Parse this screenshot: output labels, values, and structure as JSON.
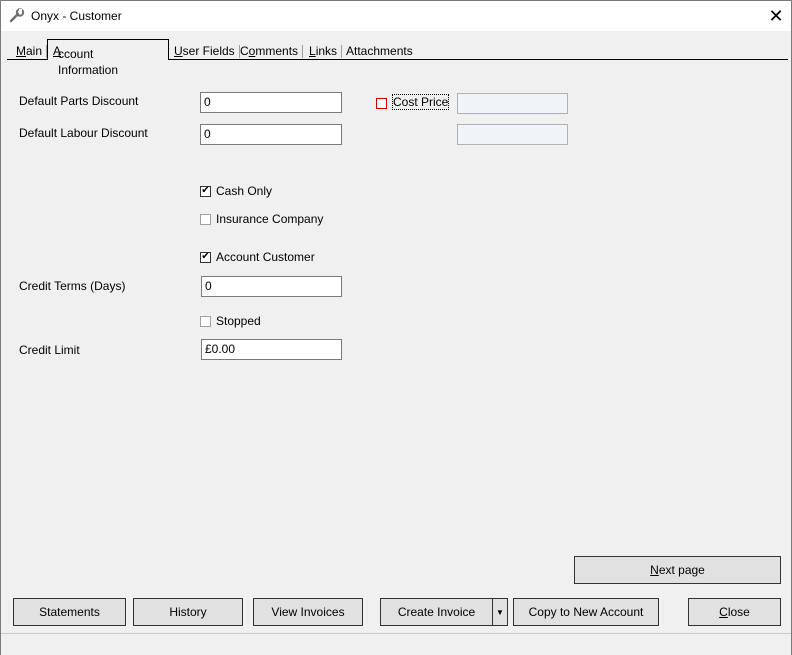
{
  "window": {
    "title": "Onyx - Customer",
    "close_glyph": "✕"
  },
  "tabs": [
    {
      "label_pre": "",
      "label_key": "M",
      "label_post": "ain"
    },
    {
      "label_pre": "",
      "label_key": "A",
      "label_post": "ccount Information"
    },
    {
      "label_pre": "",
      "label_key": "U",
      "label_post": "ser Fields"
    },
    {
      "label_pre": "C",
      "label_key": "o",
      "label_post": "mments"
    },
    {
      "label_pre": "",
      "label_key": "L",
      "label_post": "inks"
    },
    {
      "label_pre": "Attachments",
      "label_key": "",
      "label_post": ""
    }
  ],
  "form": {
    "parts_discount_label": "Default Parts Discount",
    "parts_discount_value": "0",
    "labour_discount_label": "Default Labour Discount",
    "labour_discount_value": "0",
    "cost_price_label": "Cost Price",
    "cost_price_checked": false,
    "cash_only_label": "Cash Only",
    "cash_only_checked": true,
    "insurance_label": "Insurance Company",
    "insurance_checked": false,
    "account_customer_label": "Account Customer",
    "account_customer_checked": true,
    "credit_terms_label": "Credit Terms (Days)",
    "credit_terms_value": "0",
    "stopped_label": "Stopped",
    "stopped_checked": false,
    "credit_limit_label": "Credit Limit",
    "credit_limit_value": "£0.00"
  },
  "buttons": {
    "next_page_pre": "",
    "next_page_key": "N",
    "next_page_post": "ext page",
    "statements": "Statements",
    "history": "History",
    "view_invoices": "View Invoices",
    "create_invoice": "Create Invoice",
    "copy_account": "Copy to New Account",
    "close_key": "C",
    "close_post": "lose"
  },
  "colors": {
    "accent_red": "#d00000"
  },
  "icons": {
    "app": "wrench-icon",
    "check": "✔",
    "dropdown": "▼"
  }
}
